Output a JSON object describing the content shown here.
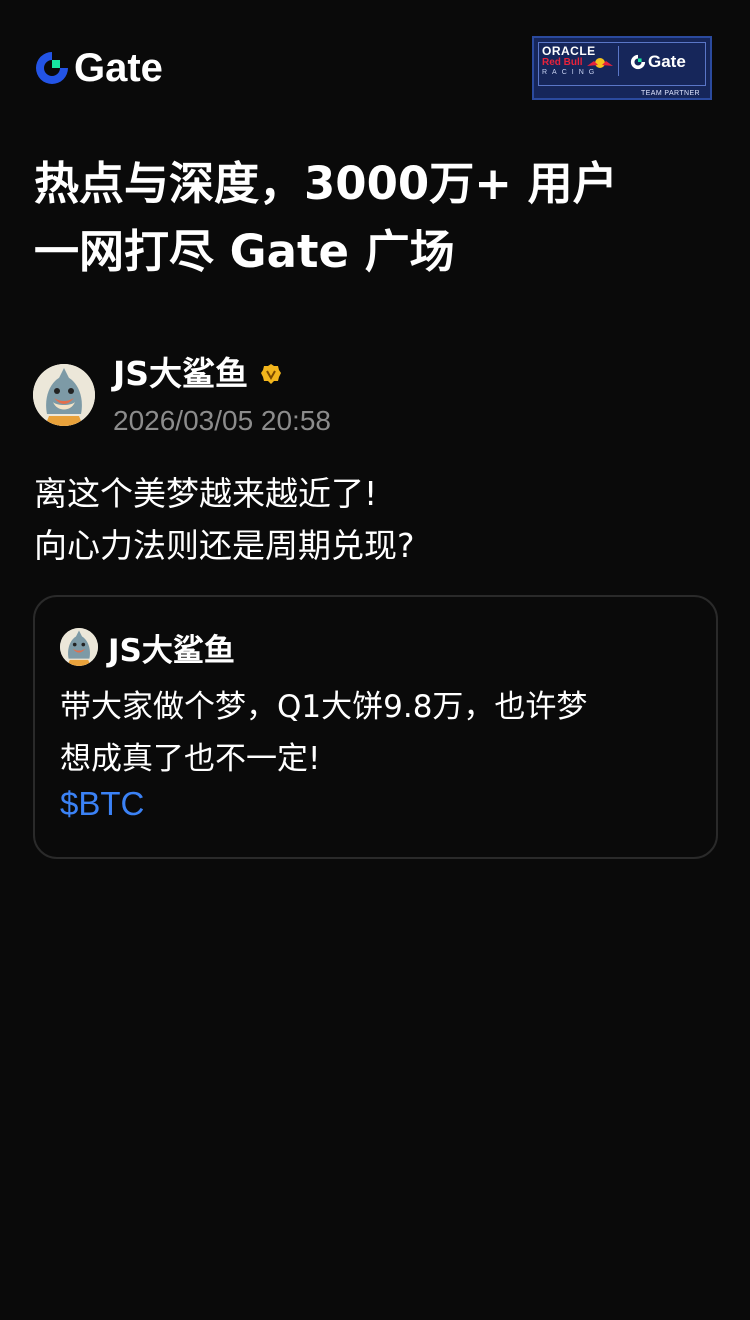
{
  "header": {
    "logo_text": "Gate",
    "partner": {
      "oracle": "ORACLE",
      "redbull": "Red Bull",
      "racing": "RACING",
      "gate": "Gate",
      "footer": "TEAM PARTNER"
    }
  },
  "headline": {
    "line1": "热点与深度，3000万+ 用户",
    "line2": "一网打尽 Gate 广场"
  },
  "post": {
    "author": "JS大鲨鱼",
    "verified_icon": "verified-badge-icon",
    "timestamp": "2026/03/05 20:58",
    "text_line1": "离这个美梦越来越近了!",
    "text_line2": "向心力法则还是周期兑现?",
    "quote": {
      "author": "JS大鲨鱼",
      "line1": "带大家做个梦，Q1大饼9.8万，也许梦",
      "line2": "想成真了也不一定!",
      "tag": "$BTC"
    }
  },
  "colors": {
    "background": "#0a0a0a",
    "brand_blue": "#2354e6",
    "brand_green": "#17e6a1",
    "link_blue": "#3b82f6",
    "timestamp_gray": "#8c8c8c",
    "verify_gold": "#f2b51c"
  }
}
